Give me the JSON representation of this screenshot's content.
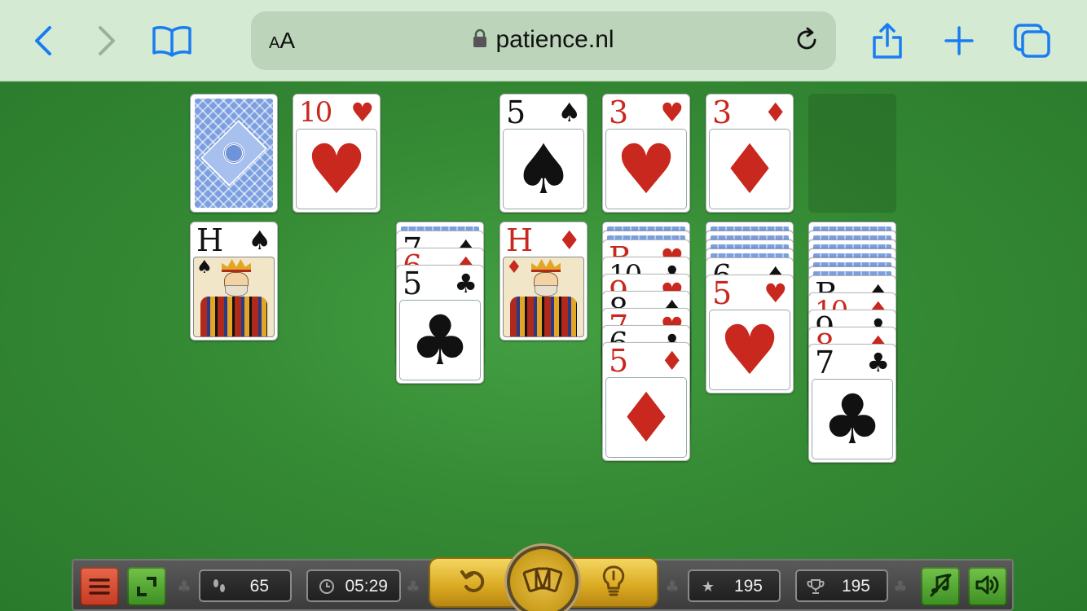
{
  "browser": {
    "text_size_small": "A",
    "text_size_big": "A",
    "url": "patience.nl",
    "icons": [
      "back-icon",
      "forward-icon",
      "bookmarks-icon",
      "lock-icon",
      "reload-icon",
      "share-icon",
      "new-tab-icon",
      "tabs-icon"
    ]
  },
  "game": {
    "stock": {
      "face": "down"
    },
    "waste": {
      "rank": "10",
      "suit": "♥",
      "color": "red"
    },
    "foundations": [
      {
        "rank": "5",
        "suit": "♠",
        "color": "black"
      },
      {
        "rank": "3",
        "suit": "♥",
        "color": "red"
      },
      {
        "rank": "3",
        "suit": "♦",
        "color": "red"
      },
      {
        "rank": "",
        "suit": "",
        "color": "empty"
      }
    ],
    "tableau": [
      {
        "hidden": 0,
        "cards": [
          {
            "rank": "H",
            "suit": "♠",
            "color": "black",
            "face": "king"
          }
        ]
      },
      {
        "hidden": 0,
        "cards": []
      },
      {
        "hidden": 1,
        "cards": [
          {
            "rank": "7",
            "suit": "♠",
            "color": "black"
          },
          {
            "rank": "6",
            "suit": "♦",
            "color": "red"
          },
          {
            "rank": "5",
            "suit": "♣",
            "color": "black"
          }
        ]
      },
      {
        "hidden": 0,
        "cards": [
          {
            "rank": "H",
            "suit": "♦",
            "color": "red",
            "face": "king"
          }
        ]
      },
      {
        "hidden": 2,
        "cards": [
          {
            "rank": "B",
            "suit": "♥",
            "color": "red"
          },
          {
            "rank": "10",
            "suit": "♣",
            "color": "black"
          },
          {
            "rank": "9",
            "suit": "♥",
            "color": "red"
          },
          {
            "rank": "8",
            "suit": "♠",
            "color": "black"
          },
          {
            "rank": "7",
            "suit": "♥",
            "color": "red"
          },
          {
            "rank": "6",
            "suit": "♣",
            "color": "black"
          },
          {
            "rank": "5",
            "suit": "♦",
            "color": "red"
          }
        ]
      },
      {
        "hidden": 4,
        "cards": [
          {
            "rank": "6",
            "suit": "♠",
            "color": "black"
          },
          {
            "rank": "5",
            "suit": "♥",
            "color": "red"
          }
        ]
      },
      {
        "hidden": 6,
        "cards": [
          {
            "rank": "B",
            "suit": "♠",
            "color": "black"
          },
          {
            "rank": "10",
            "suit": "♦",
            "color": "red"
          },
          {
            "rank": "9",
            "suit": "♣",
            "color": "black"
          },
          {
            "rank": "8",
            "suit": "♦",
            "color": "red"
          },
          {
            "rank": "7",
            "suit": "♣",
            "color": "black"
          }
        ]
      }
    ]
  },
  "toolbar": {
    "moves": "65",
    "time": "05:29",
    "score": "195",
    "best": "195",
    "icons": [
      "menu-icon",
      "fullscreen-icon",
      "footsteps-icon",
      "clock-icon",
      "undo-icon",
      "cards-icon",
      "hint-icon",
      "star-icon",
      "trophy-icon",
      "music-off-icon",
      "sound-icon"
    ]
  },
  "colors": {
    "felt": "#3a8a38",
    "browser_bar": "#d5ead3",
    "ios_blue": "#1a7cf3",
    "card_red": "#c8281e",
    "gold": "#d9a820"
  }
}
